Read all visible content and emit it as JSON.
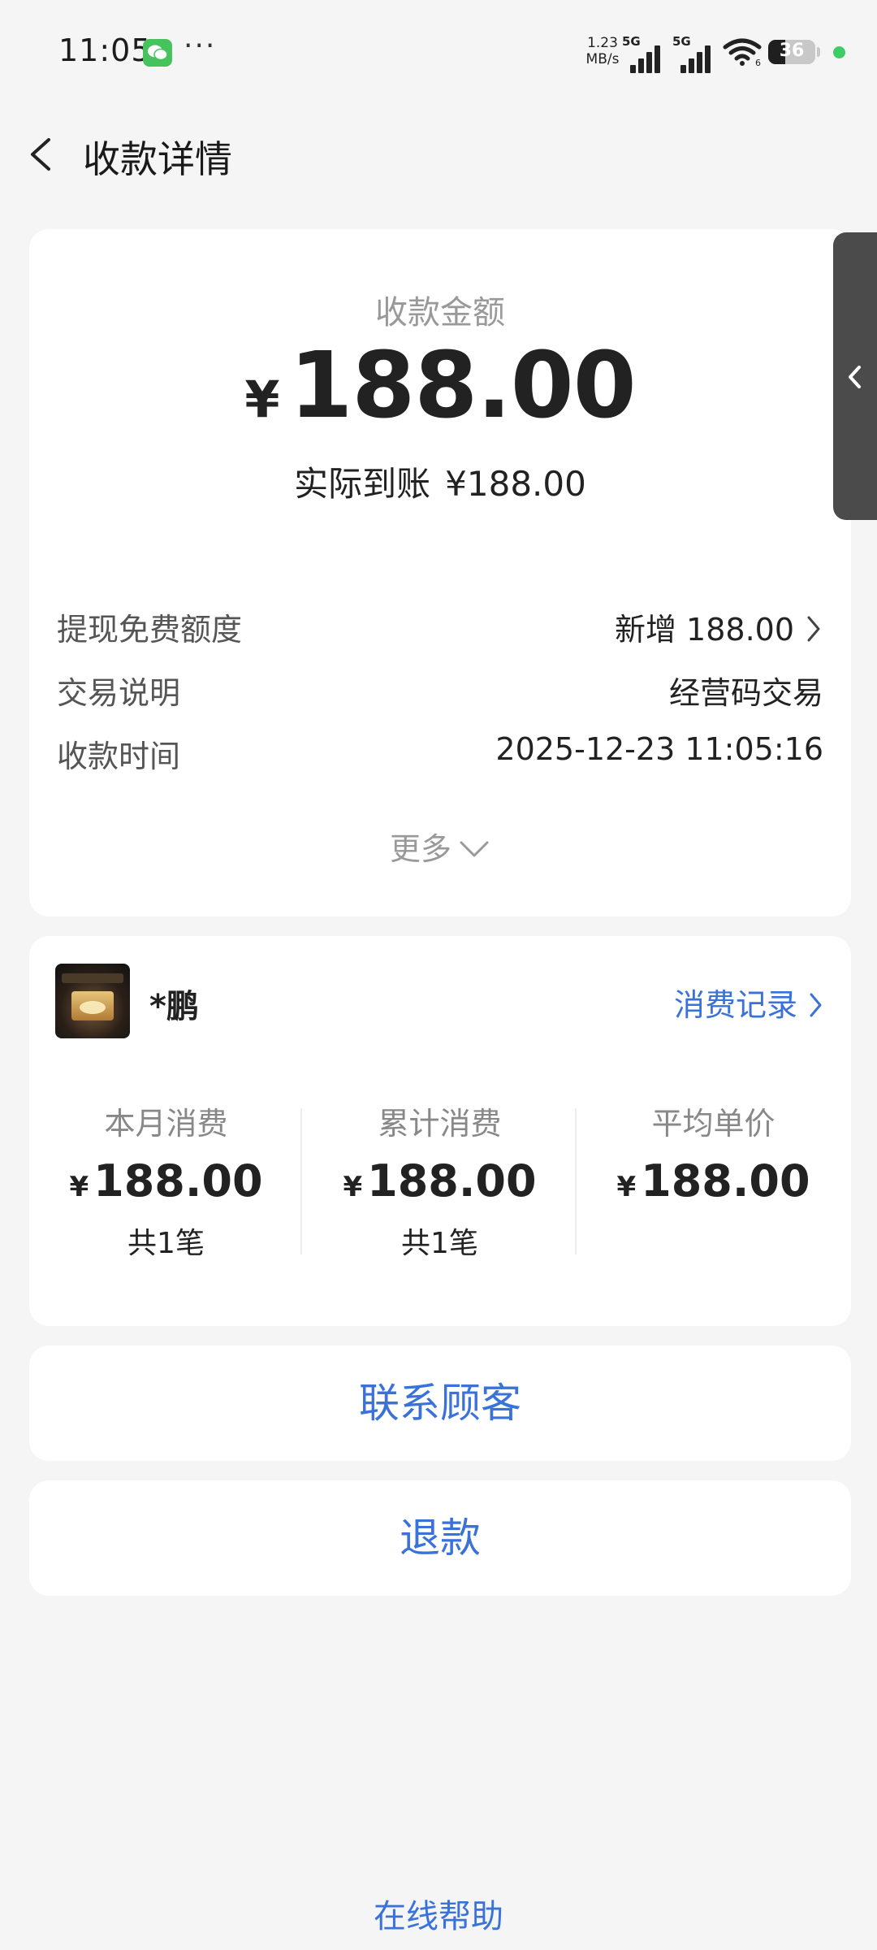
{
  "status_bar": {
    "time": "11:05",
    "app_icon": "wechat-icon",
    "dots": "···",
    "speed_value": "1.23",
    "speed_unit": "MB/s",
    "sim1_label": "5G",
    "sim2_label": "5G",
    "wifi_sub": "6",
    "battery_level": "36",
    "battery_fill_percent": 36,
    "indicator_color": "#3ccd66"
  },
  "nav": {
    "title": "收款详情",
    "back_icon": "chevron-left-icon"
  },
  "payment": {
    "amount_label": "收款金额",
    "currency_symbol": "¥",
    "amount": "188.00",
    "actual_label": "实际到账",
    "actual_value": "¥188.00",
    "details": [
      {
        "key": "提现免费额度",
        "value": "新增 188.00",
        "has_chevron": true
      },
      {
        "key": "交易说明",
        "value": "经营码交易",
        "has_chevron": false
      },
      {
        "key": "收款时间",
        "value": "2025-12-23 11:05:16",
        "has_chevron": false
      }
    ],
    "more_label": "更多"
  },
  "customer": {
    "name": "*鹏",
    "records_label": "消费记录",
    "stats": [
      {
        "label": "本月消费",
        "currency": "¥",
        "value": "188.00",
        "count": "共1笔"
      },
      {
        "label": "累计消费",
        "currency": "¥",
        "value": "188.00",
        "count": "共1笔"
      },
      {
        "label": "平均单价",
        "currency": "¥",
        "value": "188.00",
        "count": ""
      }
    ]
  },
  "actions": {
    "contact_label": "联系顾客",
    "refund_label": "退款"
  },
  "footer": {
    "help_label": "在线帮助"
  },
  "colors": {
    "accent": "#3b72d9",
    "background": "#f5f5f5",
    "card": "#ffffff"
  }
}
